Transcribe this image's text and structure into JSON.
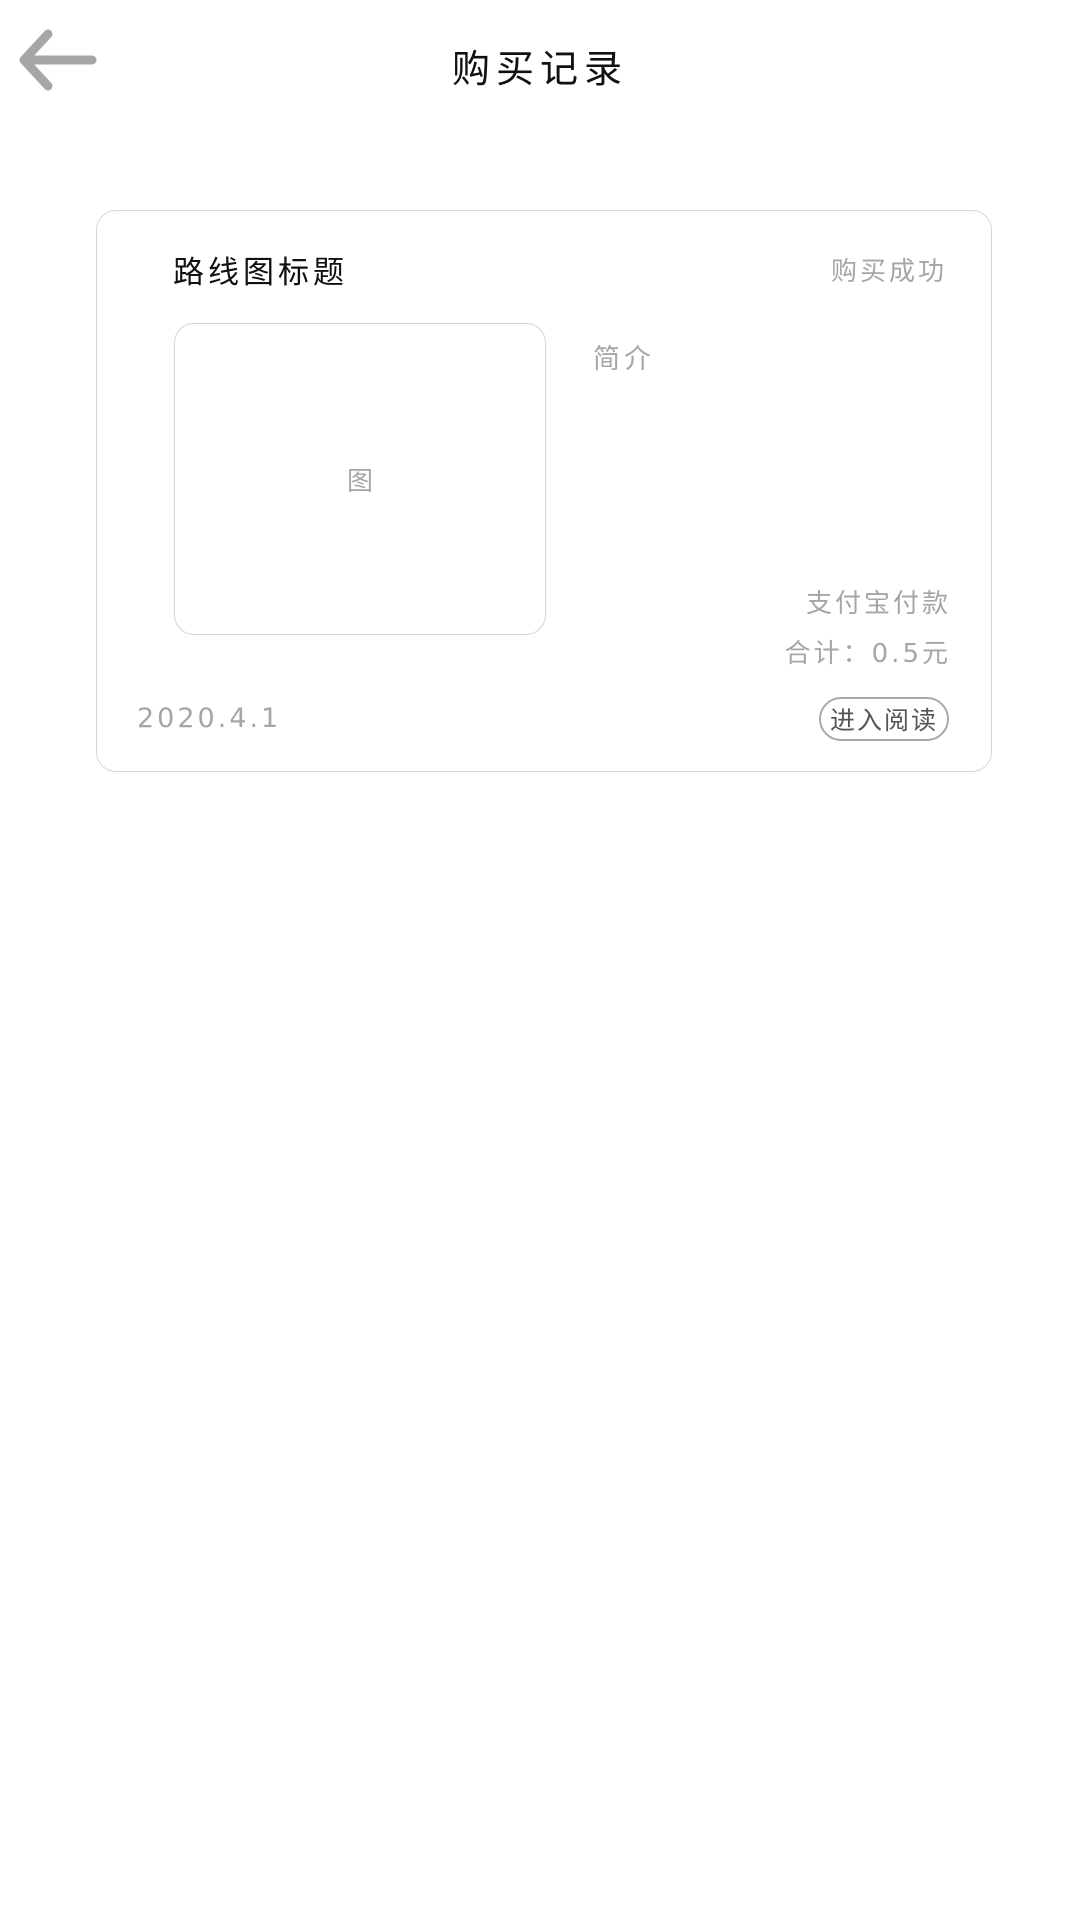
{
  "header": {
    "back_icon": "arrow-left-icon",
    "title": "购买记录"
  },
  "records": [
    {
      "title": "路线图标题",
      "status": "购买成功",
      "thumbnail_label": "图",
      "intro": "简介",
      "payment_method": "支付宝付款",
      "total": "合计：0.5元",
      "date": "2020.4.1",
      "action_label": "进入阅读"
    }
  ],
  "colors": {
    "text_primary": "#111111",
    "text_secondary": "#a6a6a6",
    "border": "#d8d8d8",
    "back_icon": "#a6a6a6"
  }
}
